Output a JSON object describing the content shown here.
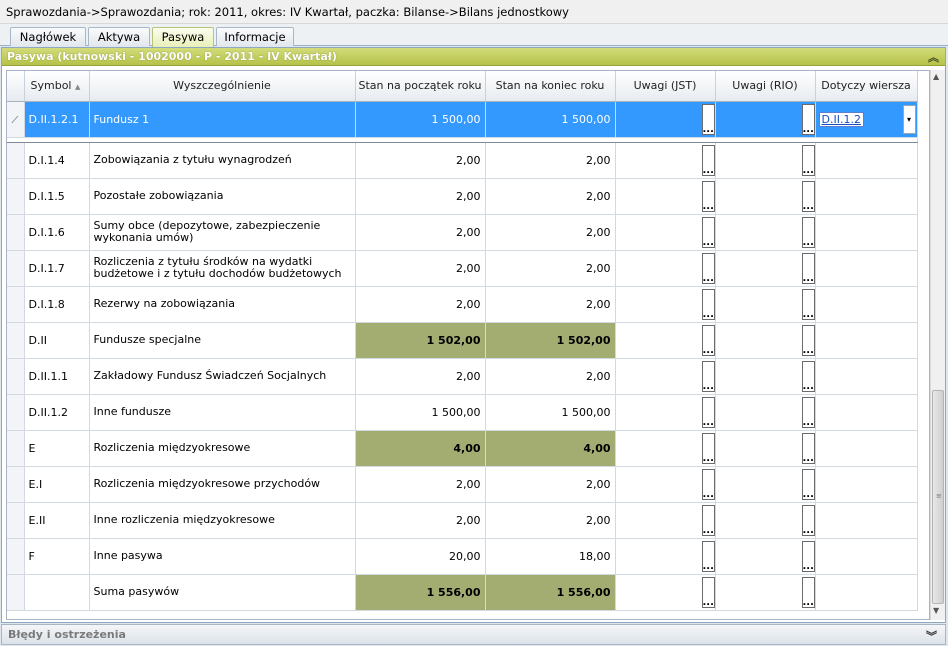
{
  "window": {
    "title": "Sprawozdania->Sprawozdania; rok: 2011, okres: IV Kwartał, paczka: Bilanse->Bilans jednostkowy"
  },
  "tabs": [
    {
      "label": "Nagłówek",
      "active": false
    },
    {
      "label": "Aktywa",
      "active": false
    },
    {
      "label": "Pasywa",
      "active": true
    },
    {
      "label": "Informacje",
      "active": false
    }
  ],
  "panel": {
    "title": "Pasywa  (kutnowski - 1002000 - P - 2011 - IV Kwartał)",
    "collapse_icon": "double-chevron-up-icon"
  },
  "grid": {
    "columns": [
      "Symbol",
      "Wyszczególnienie",
      "Stan na początek roku",
      "Stan na koniec roku",
      "Uwagi (JST)",
      "Uwagi (RIO)",
      "Dotyczy wiersza"
    ],
    "sort_indicator": "▲",
    "selected_row": {
      "symbol": "D.II.1.2.1",
      "name": "Fundusz 1",
      "start": "1 500,00",
      "end": "1 500,00",
      "dotyczy": "D.II.1.2"
    },
    "ellipsis_label": "...",
    "dropdown_arrow": "▾",
    "edit_marker": "⁄",
    "rows": [
      {
        "symbol": "D.I.1.4",
        "name": "Zobowiązania z tytułu wynagrodzeń",
        "start": "2,00",
        "end": "2,00",
        "summary": false
      },
      {
        "symbol": "D.I.1.5",
        "name": "Pozostałe zobowiązania",
        "start": "2,00",
        "end": "2,00",
        "summary": false
      },
      {
        "symbol": "D.I.1.6",
        "name": "Sumy obce (depozytowe, zabezpieczenie wykonania umów)",
        "start": "2,00",
        "end": "2,00",
        "summary": false
      },
      {
        "symbol": "D.I.1.7",
        "name": "Rozliczenia z tytułu środków na wydatki budżetowe i z tytułu dochodów budżetowych",
        "start": "2,00",
        "end": "2,00",
        "summary": false
      },
      {
        "symbol": "D.I.1.8",
        "name": "Rezerwy na zobowiązania",
        "start": "2,00",
        "end": "2,00",
        "summary": false
      },
      {
        "symbol": "D.II",
        "name": "Fundusze specjalne",
        "start": "1 502,00",
        "end": "1 502,00",
        "summary": true
      },
      {
        "symbol": "D.II.1.1",
        "name": "Zakładowy Fundusz Świadczeń Socjalnych",
        "start": "2,00",
        "end": "2,00",
        "summary": false
      },
      {
        "symbol": "D.II.1.2",
        "name": "Inne fundusze",
        "start": "1 500,00",
        "end": "1 500,00",
        "summary": false
      },
      {
        "symbol": "E",
        "name": "Rozliczenia międzyokresowe",
        "start": "4,00",
        "end": "4,00",
        "summary": true
      },
      {
        "symbol": "E.I",
        "name": "Rozliczenia międzyokresowe przychodów",
        "start": "2,00",
        "end": "2,00",
        "summary": false
      },
      {
        "symbol": "E.II",
        "name": "Inne rozliczenia międzyokresowe",
        "start": "2,00",
        "end": "2,00",
        "summary": false
      },
      {
        "symbol": "F",
        "name": "Inne pasywa",
        "start": "20,00",
        "end": "18,00",
        "summary": false
      },
      {
        "symbol": "",
        "name": "Suma pasywów",
        "start": "1 556,00",
        "end": "1 556,00",
        "summary": true
      }
    ]
  },
  "scrollbar": {
    "up": "▲",
    "down": "▼",
    "grip": "≡"
  },
  "bottom_panel": {
    "title": "Błędy i ostrzeżenia",
    "expand_icon": "double-chevron-down-icon"
  },
  "icons": {
    "collapse": "︽",
    "expand": "︾"
  },
  "colors": {
    "accent_header": "#b5c247",
    "summary_cell": "#a3ad72",
    "selection": "#3399ff"
  }
}
